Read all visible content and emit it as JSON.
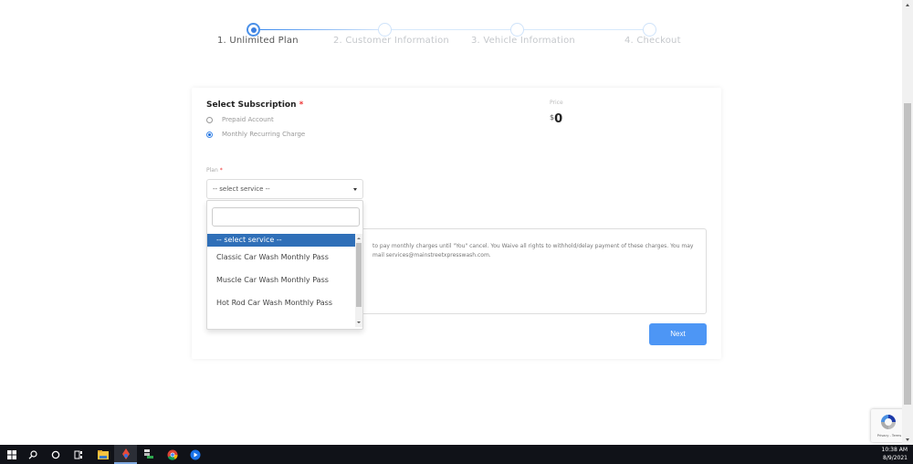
{
  "stepper": {
    "steps": [
      {
        "label": "1. Unlimited Plan",
        "active": true
      },
      {
        "label": "2. Customer Information",
        "active": false
      },
      {
        "label": "3. Vehicle Information",
        "active": false
      },
      {
        "label": "4. Checkout",
        "active": false
      }
    ]
  },
  "subscription": {
    "title": "Select Subscription",
    "required_mark": "*",
    "options": [
      {
        "label": "Prepaid Account",
        "checked": false
      },
      {
        "label": "Monthly Recurring Charge",
        "checked": true
      }
    ]
  },
  "price": {
    "label": "Price",
    "currency": "$",
    "value": "0"
  },
  "plan": {
    "label": "Plan",
    "required_mark": "*",
    "selected": "-- select service --",
    "search_value": "",
    "options": [
      {
        "label": "-- select service --",
        "selected": true
      },
      {
        "label": "Classic Car Wash Monthly Pass",
        "selected": false
      },
      {
        "label": "Muscle Car Wash Monthly Pass",
        "selected": false
      },
      {
        "label": "Hot Rod Car Wash Monthly Pass",
        "selected": false
      }
    ]
  },
  "terms": {
    "line1": "to pay monthly charges until \"You\" cancel. You Waive all rights to withhold/delay payment of these charges. You may",
    "line2": "mail services@mainstreetxpresswash.com."
  },
  "actions": {
    "next_label": "Next"
  },
  "recaptcha": {
    "text": "Privacy - Terms"
  },
  "taskbar": {
    "icons": [
      "windows-start-icon",
      "search-icon",
      "cortana-icon",
      "task-view-icon",
      "file-explorer-icon",
      "app-icon",
      "network-app-icon",
      "chrome-icon",
      "media-app-icon"
    ],
    "time": "10:38 AM",
    "date": "8/9/2021"
  },
  "colors": {
    "accent": "#4d96f5",
    "selected_option": "#2f6fb8",
    "required": "#e33333"
  }
}
